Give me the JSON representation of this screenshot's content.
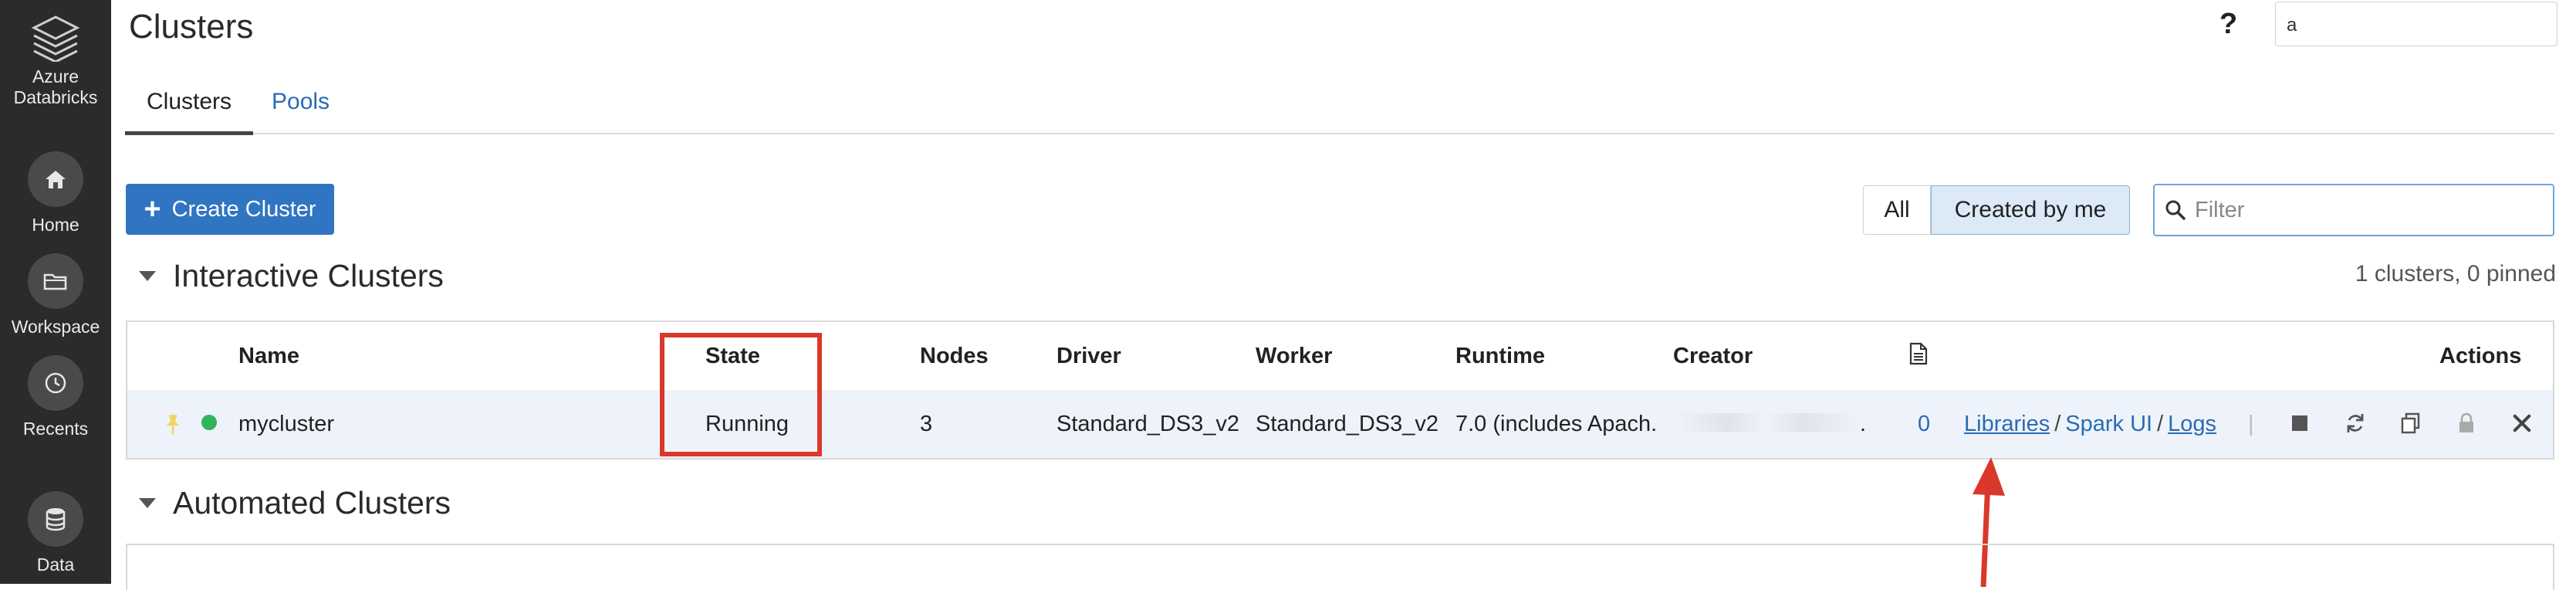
{
  "sidebar": {
    "brand": "Azure Databricks",
    "items": [
      {
        "label": "Home",
        "icon": "home-icon"
      },
      {
        "label": "Workspace",
        "icon": "folder-icon"
      },
      {
        "label": "Recents",
        "icon": "clock-icon"
      },
      {
        "label": "Data",
        "icon": "database-icon"
      }
    ]
  },
  "header": {
    "title": "Clusters",
    "help": "?",
    "user_initial": "a"
  },
  "tabs": [
    {
      "label": "Clusters",
      "active": true
    },
    {
      "label": "Pools",
      "active": false
    }
  ],
  "toolbar": {
    "create_label": "Create Cluster",
    "filter_all": "All",
    "filter_mine": "Created by me",
    "filter_placeholder": "Filter"
  },
  "interactive": {
    "title": "Interactive Clusters",
    "count_text": "1 clusters, 0 pinned",
    "columns": [
      "Name",
      "State",
      "Nodes",
      "Driver",
      "Worker",
      "Runtime",
      "Creator",
      "",
      "Actions"
    ],
    "rows": [
      {
        "name": "mycluster",
        "state": "Running",
        "nodes": "3",
        "driver": "Standard_DS3_v2",
        "worker": "Standard_DS3_v2",
        "runtime": "7.0 (includes Apach.",
        "creator": ".",
        "notebooks": "0",
        "link_libraries": "Libraries",
        "link_sparkui": "Spark UI",
        "link_logs": "Logs",
        "sep": "/",
        "divider": "|"
      }
    ]
  },
  "automated": {
    "title": "Automated Clusters"
  },
  "colors": {
    "sidebar_bg": "#2b2b2b",
    "accent": "#2f75c2",
    "link": "#2a6bb4",
    "running_dot": "#2fb45a",
    "highlight": "#d9382b",
    "row_bg": "#eef3fb"
  }
}
